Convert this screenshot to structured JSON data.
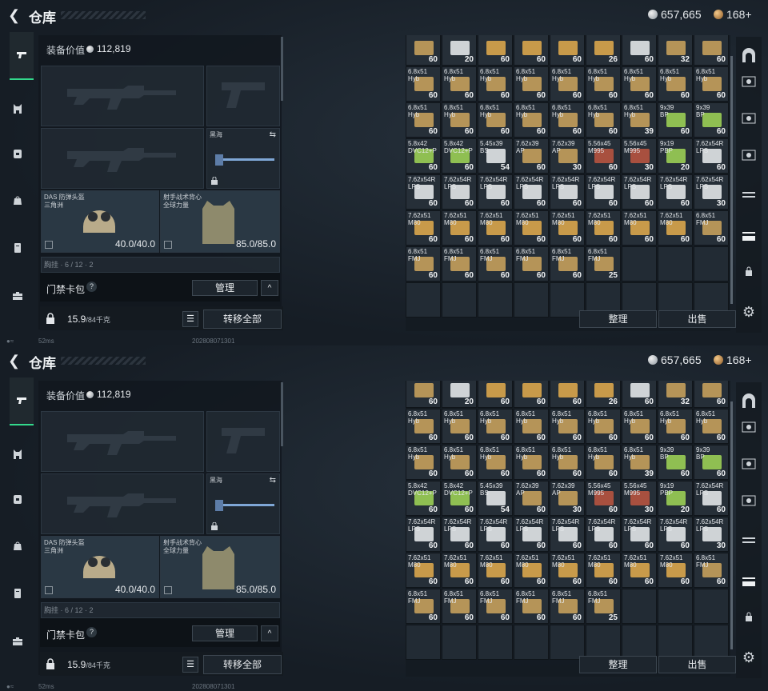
{
  "header": {
    "title": "仓库",
    "silver": "657,665",
    "bronze": "168+"
  },
  "equipment": {
    "title": "装备价值",
    "value": "112,819",
    "slots": {
      "melee": {
        "line1": "黑海"
      },
      "helmet": {
        "line1": "DAS 防弹头盔",
        "line2": "三角洲",
        "dura": "40.0/40.0"
      },
      "armor": {
        "line1": "射手战术背心",
        "line2": "全球力量",
        "dura": "85.0/85.0"
      },
      "chest_partial": "胸挂 · 6 / 12 · 2"
    }
  },
  "keycard": {
    "label": "门禁卡包",
    "help": "?",
    "manage": "管理",
    "collapse": "^"
  },
  "bottom": {
    "weight": "15.9",
    "weight_unit": "/84千克",
    "transfer_all": "转移全部"
  },
  "footer": {
    "ping": "52ms",
    "build": "202808071301"
  },
  "actions": {
    "sort": "整理",
    "sell": "出售"
  },
  "colors": {
    "accent": "#33d98c",
    "ammo_tan": "#b59458",
    "ammo_white": "#cfd3d6",
    "ammo_green": "#8fbf52",
    "ammo_red": "#a8503f",
    "ammo_gold": "#c89a4a"
  },
  "icons": {
    "left_nav": [
      "pistol-icon",
      "chest-rig-icon",
      "backpack-icon",
      "bag-icon",
      "container-icon",
      "toolbox-icon"
    ],
    "right_nav": [
      "tunnel-icon",
      "vault-icon",
      "vault-icon",
      "vault-icon",
      "rack-icon",
      "rack-icon",
      "lock-icon",
      "settings-icon"
    ]
  },
  "inventory": [
    [
      {
        "c": "",
        "q": "60",
        "t": "tan"
      },
      {
        "c": "",
        "q": "20",
        "t": "white"
      },
      {
        "c": "",
        "q": "60",
        "t": "gold"
      },
      {
        "c": "",
        "q": "60",
        "t": "gold"
      },
      {
        "c": "",
        "q": "60",
        "t": "gold"
      },
      {
        "c": "",
        "q": "26",
        "t": "gold"
      },
      {
        "c": "",
        "q": "60",
        "t": "white"
      },
      {
        "c": "",
        "q": "32",
        "t": "tan"
      },
      {
        "c": "",
        "q": "60",
        "t": "tan"
      }
    ],
    [
      {
        "c": "6.8x51\nHyb",
        "q": "60",
        "t": "tan"
      },
      {
        "c": "6.8x51\nHyb",
        "q": "60",
        "t": "tan"
      },
      {
        "c": "6.8x51\nHyb",
        "q": "60",
        "t": "tan"
      },
      {
        "c": "6.8x51\nHyb",
        "q": "60",
        "t": "tan"
      },
      {
        "c": "6.8x51\nHyb",
        "q": "60",
        "t": "tan"
      },
      {
        "c": "6.8x51\nHyb",
        "q": "60",
        "t": "tan"
      },
      {
        "c": "6.8x51\nHyb",
        "q": "60",
        "t": "tan"
      },
      {
        "c": "6.8x51\nHyb",
        "q": "60",
        "t": "tan"
      },
      {
        "c": "6.8x51\nHyb",
        "q": "60",
        "t": "tan"
      }
    ],
    [
      {
        "c": "6.8x51\nHyb",
        "q": "60",
        "t": "tan"
      },
      {
        "c": "6.8x51\nHyb",
        "q": "60",
        "t": "tan"
      },
      {
        "c": "6.8x51\nHyb",
        "q": "60",
        "t": "tan"
      },
      {
        "c": "6.8x51\nHyb",
        "q": "60",
        "t": "tan"
      },
      {
        "c": "6.8x51\nHyb",
        "q": "60",
        "t": "tan"
      },
      {
        "c": "6.8x51\nHyb",
        "q": "60",
        "t": "tan"
      },
      {
        "c": "6.8x51\nHyb",
        "q": "39",
        "t": "tan"
      },
      {
        "c": "9x39\nBP",
        "q": "60",
        "t": "green"
      },
      {
        "c": "9x39\nBP",
        "q": "60",
        "t": "green"
      }
    ],
    [
      {
        "c": "5.8x42\nDVC12+P",
        "q": "60",
        "t": "green"
      },
      {
        "c": "5.8x42\nDVC12+P",
        "q": "60",
        "t": "green"
      },
      {
        "c": "5.45x39\nBS",
        "q": "54",
        "t": "white"
      },
      {
        "c": "7.62x39\nAP",
        "q": "60",
        "t": "tan"
      },
      {
        "c": "7.62x39\nAP",
        "q": "30",
        "t": "tan"
      },
      {
        "c": "5.56x45\nM995",
        "q": "60",
        "t": "red"
      },
      {
        "c": "5.56x45\nM995",
        "q": "30",
        "t": "red"
      },
      {
        "c": "9x19\nPBP",
        "q": "20",
        "t": "green"
      },
      {
        "c": "7.62x54R\nLPS",
        "q": "60",
        "t": "white"
      }
    ],
    [
      {
        "c": "7.62x54R\nLPS",
        "q": "60",
        "t": "white"
      },
      {
        "c": "7.62x54R\nLPS",
        "q": "60",
        "t": "white"
      },
      {
        "c": "7.62x54R\nLPS",
        "q": "60",
        "t": "white"
      },
      {
        "c": "7.62x54R\nLPS",
        "q": "60",
        "t": "white"
      },
      {
        "c": "7.62x54R\nLPS",
        "q": "60",
        "t": "white"
      },
      {
        "c": "7.62x54R\nLPS",
        "q": "60",
        "t": "white"
      },
      {
        "c": "7.62x54R\nLPS",
        "q": "60",
        "t": "white"
      },
      {
        "c": "7.62x54R\nLPS",
        "q": "60",
        "t": "white"
      },
      {
        "c": "7.62x54R\nLPS",
        "q": "30",
        "t": "white"
      }
    ],
    [
      {
        "c": "7.62x51\nM80",
        "q": "60",
        "t": "gold"
      },
      {
        "c": "7.62x51\nM80",
        "q": "60",
        "t": "gold"
      },
      {
        "c": "7.62x51\nM80",
        "q": "60",
        "t": "gold"
      },
      {
        "c": "7.62x51\nM80",
        "q": "60",
        "t": "gold"
      },
      {
        "c": "7.62x51\nM80",
        "q": "60",
        "t": "gold"
      },
      {
        "c": "7.62x51\nM80",
        "q": "60",
        "t": "gold"
      },
      {
        "c": "7.62x51\nM80",
        "q": "60",
        "t": "gold"
      },
      {
        "c": "7.62x51\nM80",
        "q": "60",
        "t": "gold"
      },
      {
        "c": "6.8x51\nFMJ",
        "q": "60",
        "t": "tan"
      }
    ],
    [
      {
        "c": "6.8x51\nFMJ",
        "q": "60",
        "t": "tan"
      },
      {
        "c": "6.8x51\nFMJ",
        "q": "60",
        "t": "tan"
      },
      {
        "c": "6.8x51\nFMJ",
        "q": "60",
        "t": "tan"
      },
      {
        "c": "6.8x51\nFMJ",
        "q": "60",
        "t": "tan"
      },
      {
        "c": "6.8x51\nFMJ",
        "q": "60",
        "t": "tan"
      },
      {
        "c": "6.8x51\nFMJ",
        "q": "25",
        "t": "tan"
      }
    ]
  ]
}
